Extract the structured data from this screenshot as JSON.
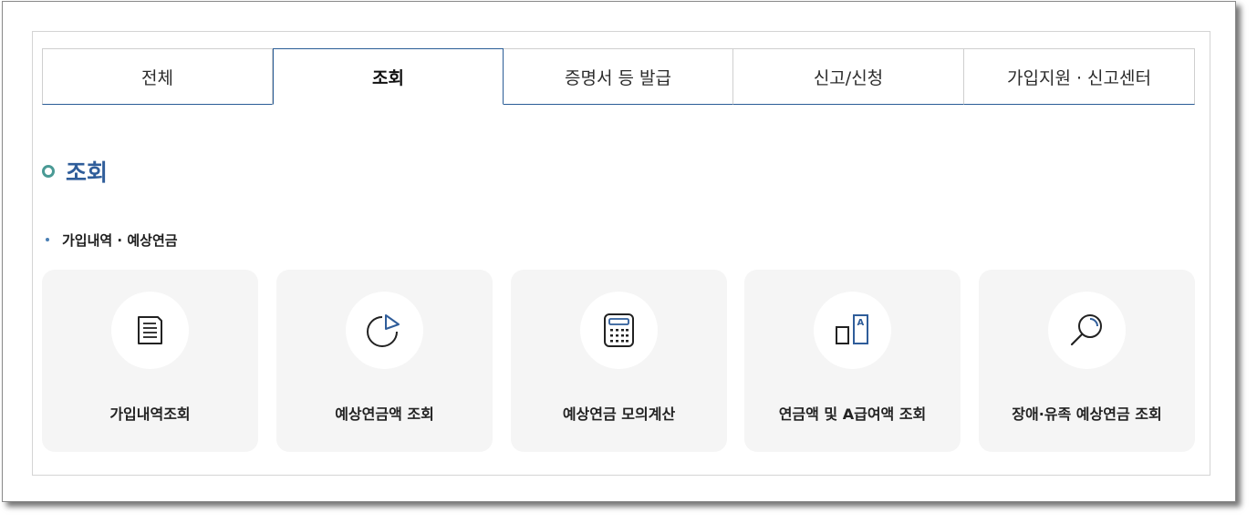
{
  "tabs": [
    {
      "label": "전체",
      "active": false
    },
    {
      "label": "조회",
      "active": true
    },
    {
      "label": "증명서 등 발급",
      "active": false
    },
    {
      "label": "신고/신청",
      "active": false
    },
    {
      "label": "가입지원 · 신고센터",
      "active": false
    }
  ],
  "section": {
    "title": "조회"
  },
  "subsection": {
    "title": "가입내역 · 예상연금"
  },
  "cards": [
    {
      "label": "가입내역조회",
      "icon": "document-icon"
    },
    {
      "label": "예상연금액 조회",
      "icon": "pie-chart-icon"
    },
    {
      "label": "예상연금 모의계산",
      "icon": "calculator-icon"
    },
    {
      "label": "연금액 및 A급여액 조회",
      "icon": "compare-a-icon"
    },
    {
      "label": "장애·유족 예상연금 조회",
      "icon": "magnifier-icon"
    }
  ],
  "colors": {
    "accent": "#2f5d9a",
    "tab_border": "#2a5d96",
    "ring": "#4a9a95",
    "card_bg": "#f5f5f5"
  }
}
